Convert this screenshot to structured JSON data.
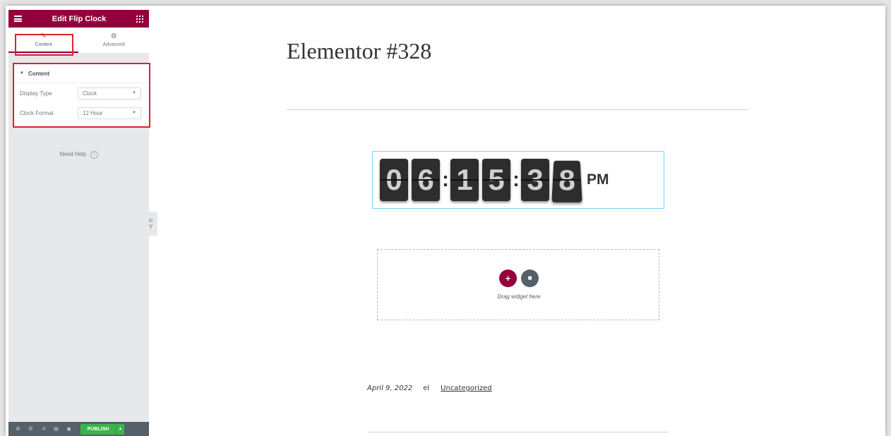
{
  "sidebar": {
    "title": "Edit Flip Clock",
    "tabs": [
      {
        "label": "Content",
        "icon": "pencil-icon"
      },
      {
        "label": "Advanced",
        "icon": "gear-icon"
      }
    ],
    "section_title": "Content",
    "controls": [
      {
        "label": "Display Type",
        "value": "Clock"
      },
      {
        "label": "Clock Format",
        "value": "12 Hour"
      }
    ],
    "help_label": "Need Help",
    "help_icon_glyph": "?",
    "publish_label": "PUBLISH",
    "collapse_glyph": "ic Y"
  },
  "page": {
    "title": "Elementor #328",
    "clock": {
      "digits": [
        "0",
        "6",
        "1",
        "5",
        "3",
        "8"
      ],
      "separator": ":",
      "meridiem": "PM"
    },
    "drop_text": "Drag widget here",
    "add_glyph": "+",
    "meta": {
      "date": "April 9, 2022",
      "author": "el",
      "category": "Uncategorized"
    }
  },
  "colors": {
    "brand": "#93003c",
    "publish": "#39b54a",
    "highlight": "#e0202a",
    "selection_border": "#71d7f7"
  }
}
